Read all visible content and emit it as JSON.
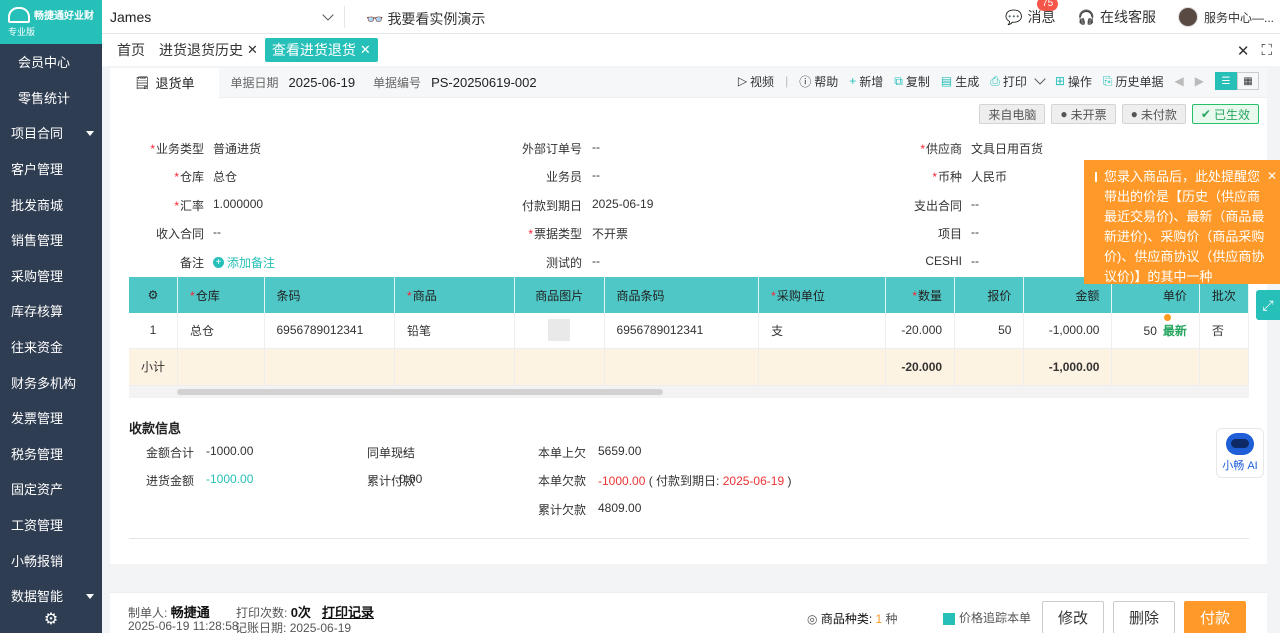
{
  "app": {
    "brand": "畅捷通好业财",
    "edition": "专业版"
  },
  "sidebar": {
    "items": [
      {
        "label": "会员中心"
      },
      {
        "label": "零售统计"
      },
      {
        "label": "项目合同"
      },
      {
        "label": "客户管理"
      },
      {
        "label": "批发商城"
      },
      {
        "label": "销售管理"
      },
      {
        "label": "采购管理"
      },
      {
        "label": "库存核算"
      },
      {
        "label": "往来资金"
      },
      {
        "label": "财务多机构"
      },
      {
        "label": "发票管理"
      },
      {
        "label": "税务管理"
      },
      {
        "label": "固定资产"
      },
      {
        "label": "工资管理"
      },
      {
        "label": "小畅报销"
      },
      {
        "label": "数据智能"
      }
    ]
  },
  "topbar": {
    "user": "James",
    "demo": "我要看实例演示",
    "messages": "消息",
    "message_count": "75",
    "support": "在线客服",
    "service": "服务中心—..."
  },
  "tabs": [
    {
      "label": "首页"
    },
    {
      "label": "进货退货历史"
    },
    {
      "label": "查看进货退货"
    }
  ],
  "doc": {
    "tab": "退货单",
    "date_label": "单据日期",
    "date": "2025-06-19",
    "no_label": "单据编号",
    "no": "PS-20250619-002"
  },
  "toolbar": {
    "video": "视频",
    "help": "帮助",
    "add": "新增",
    "copy": "复制",
    "generate": "生成",
    "print": "打印",
    "operate": "操作",
    "history": "历史单据"
  },
  "status": {
    "source": "来自电脑",
    "invoice": "未开票",
    "payment": "未付款",
    "effective": "已生效"
  },
  "form": {
    "biz_type_label": "业务类型",
    "biz_type": "普通进货",
    "ext_order_label": "外部订单号",
    "ext_order": "--",
    "supplier_label": "供应商",
    "supplier": "文具日用百货",
    "warehouse_label": "仓库",
    "warehouse": "总仓",
    "clerk_label": "业务员",
    "clerk": "--",
    "currency_label": "币种",
    "currency": "人民币",
    "rate_label": "汇率",
    "rate": "1.000000",
    "due_label": "付款到期日",
    "due": "2025-06-19",
    "pay_contract_label": "支出合同",
    "pay_contract": "--",
    "income_contract_label": "收入合同",
    "income_contract": "--",
    "bill_type_label": "票据类型",
    "bill_type": "不开票",
    "project_label": "项目",
    "project": "--",
    "note_label": "备注",
    "add_note": "添加备注",
    "test_label": "测试的",
    "test": "--",
    "ceshi_label": "CESHI",
    "ceshi": "--"
  },
  "table": {
    "headers": [
      "仓库",
      "条码",
      "商品",
      "商品图片",
      "商品条码",
      "采购单位",
      "数量",
      "报价",
      "金额",
      "单价",
      "批次"
    ],
    "row": {
      "index": "1",
      "warehouse": "总仓",
      "barcode": "6956789012341",
      "product": "铅笔",
      "product_barcode": "6956789012341",
      "unit": "支",
      "qty": "-20.000",
      "quote": "50",
      "amount": "-1,000.00",
      "price": "50",
      "price_tag": "最新",
      "batch": "否"
    },
    "subtotal": {
      "label": "小计",
      "qty": "-20.000",
      "amount": "-1,000.00"
    }
  },
  "payment": {
    "title": "收款信息",
    "total_label": "金额合计",
    "total": "-1000.00",
    "cash_label": "同单现结",
    "cash": "--",
    "prev_debt_label": "本单上欠",
    "prev_debt": "5659.00",
    "purchase_label": "进货金额",
    "purchase": "-1000.00",
    "paid_label": "累计付款",
    "paid": "0.00",
    "debt_label": "本单欠款",
    "debt": "-1000.00",
    "due_open": "( 付款到期日:",
    "due_date": "2025-06-19",
    "due_close": ")",
    "acc_debt_label": "累计欠款",
    "acc_debt": "4809.00"
  },
  "tip": {
    "text": "您录入商品后，此处提醒您带出的价是【历史（供应商最近交易价)、最新（商品最新进价)、采购价（商品采购价)、供应商协议（供应商协议价)】的其中一种"
  },
  "ai": {
    "label": "小畅 AI"
  },
  "footer": {
    "maker_label": "制单人:",
    "maker": "畅捷通",
    "print_label": "打印次数:",
    "print_count": "0次",
    "print_log": "打印记录",
    "created": "2025-06-19 11:28:58",
    "record_label": "记账日期:",
    "record_date": "2025-06-19",
    "kinds_label": "商品种类:",
    "kinds": "1",
    "kinds_unit": "种",
    "trace": "价格追踪本单",
    "edit": "修改",
    "delete": "删除",
    "pay": "付款"
  }
}
